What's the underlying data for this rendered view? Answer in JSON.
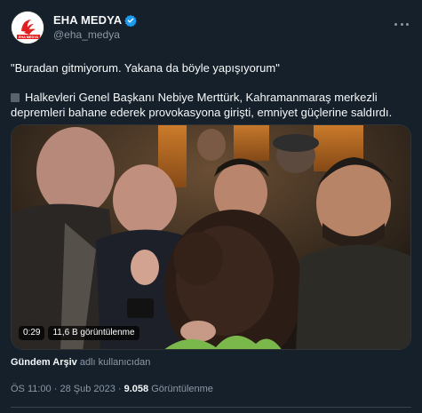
{
  "account": {
    "display_name": "EHA MEDYA",
    "handle": "@eha_medya",
    "avatar_text": "EHA MEDYA",
    "verified_icon": "verified-badge-icon",
    "more_icon": "more-icon"
  },
  "tweet": {
    "quote": "\"Buradan gitmiyorum. Yakana da böyle yapışıyorum\"",
    "body": "Halkevleri Genel Başkanı Nebiye Merttürk, Kahramanmaraş merkezli depremleri bahane ederek provokasyona girişti, emniyet güçlerine saldırdı."
  },
  "media": {
    "duration": "0:29",
    "views": "11,6 B görüntülenme"
  },
  "attribution": {
    "source": "Gündem Arşiv",
    "suffix": "adlı kullanıcıdan"
  },
  "meta": {
    "time": "ÖS 11:00",
    "sep1": " · ",
    "date": "28 Şub 2023",
    "sep2": " · ",
    "view_count": "9.058",
    "view_label": " Görüntülenme"
  },
  "colors": {
    "background": "#15202b",
    "text": "#f7f9f9",
    "secondary": "#8b98a5",
    "verified": "#1d9bf0",
    "brand": "#e02020"
  }
}
